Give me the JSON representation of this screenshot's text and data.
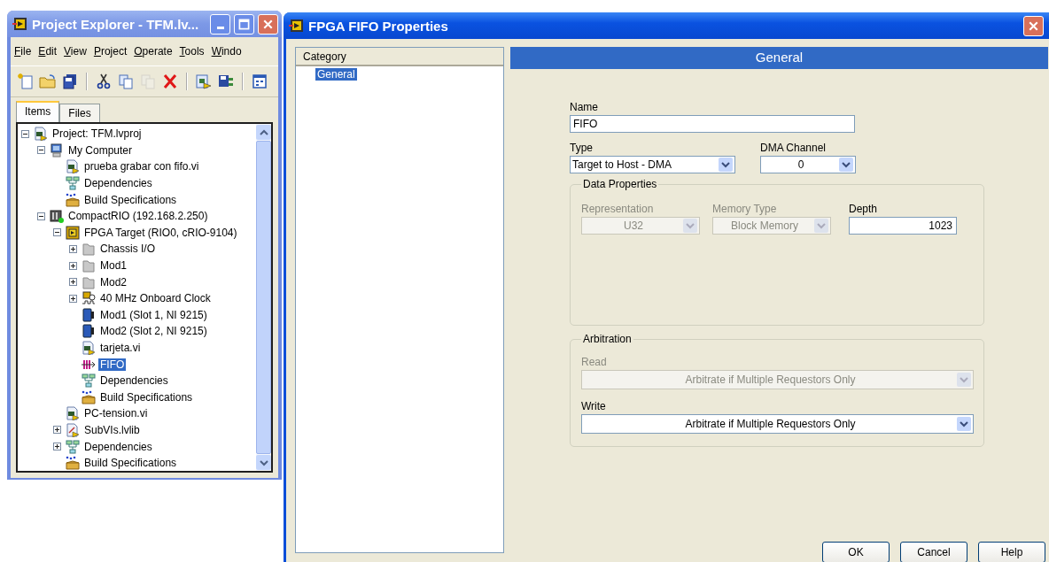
{
  "project_explorer": {
    "title": "Project Explorer - TFM.lv...",
    "menu": [
      "File",
      "Edit",
      "View",
      "Project",
      "Operate",
      "Tools",
      "Windo"
    ],
    "toolbar_groups": [
      {
        "tools": [
          {
            "kind": "new",
            "disabled": false
          },
          {
            "kind": "open",
            "disabled": false
          },
          {
            "kind": "save_all",
            "disabled": false
          }
        ]
      },
      {
        "tools": [
          {
            "kind": "cut",
            "disabled": false
          },
          {
            "kind": "copy",
            "disabled": false
          },
          {
            "kind": "paste",
            "disabled": true
          },
          {
            "kind": "delete",
            "disabled": false
          }
        ]
      },
      {
        "tools": [
          {
            "kind": "build",
            "disabled": false
          },
          {
            "kind": "save_build",
            "disabled": false
          }
        ]
      },
      {
        "tools": [
          {
            "kind": "window",
            "disabled": false
          }
        ]
      }
    ],
    "tabs": [
      {
        "label": "Items",
        "selected": true
      },
      {
        "label": "Files",
        "selected": false
      }
    ],
    "tree": [
      {
        "label": "Project: TFM.lvproj",
        "kind": "project",
        "expanded": true,
        "selected": false,
        "children": [
          {
            "label": "My Computer",
            "kind": "computer",
            "expanded": true,
            "selected": false,
            "children": [
              {
                "label": "prueba grabar con fifo.vi",
                "kind": "vi",
                "selected": false
              },
              {
                "label": "Dependencies",
                "kind": "dependencies",
                "selected": false
              },
              {
                "label": "Build Specifications",
                "kind": "build",
                "selected": false
              }
            ]
          },
          {
            "label": "CompactRIO (192.168.2.250)",
            "kind": "crio",
            "expanded": true,
            "selected": false,
            "children": [
              {
                "label": "FPGA Target (RIO0, cRIO-9104)",
                "kind": "fpga",
                "expanded": true,
                "selected": false,
                "children": [
                  {
                    "label": "Chassis I/O",
                    "kind": "folder",
                    "expanded": false,
                    "selected": false
                  },
                  {
                    "label": "Mod1",
                    "kind": "folder",
                    "expanded": false,
                    "selected": false
                  },
                  {
                    "label": "Mod2",
                    "kind": "folder",
                    "expanded": false,
                    "selected": false
                  },
                  {
                    "label": "40 MHz Onboard Clock",
                    "kind": "clock",
                    "expanded": false,
                    "selected": false
                  },
                  {
                    "label": "Mod1 (Slot 1, NI 9215)",
                    "kind": "module",
                    "selected": false
                  },
                  {
                    "label": "Mod2 (Slot 2, NI 9215)",
                    "kind": "module",
                    "selected": false
                  },
                  {
                    "label": "tarjeta.vi",
                    "kind": "vi",
                    "selected": false
                  },
                  {
                    "label": "FIFO",
                    "kind": "fifo",
                    "selected": true
                  },
                  {
                    "label": "Dependencies",
                    "kind": "dependencies",
                    "selected": false
                  },
                  {
                    "label": "Build Specifications",
                    "kind": "build",
                    "selected": false
                  }
                ]
              },
              {
                "label": "PC-tension.vi",
                "kind": "vi",
                "selected": false
              },
              {
                "label": "SubVIs.lvlib",
                "kind": "library",
                "expanded": false,
                "selected": false
              },
              {
                "label": "Dependencies",
                "kind": "dependencies",
                "expanded": false,
                "selected": false
              },
              {
                "label": "Build Specifications",
                "kind": "build",
                "selected": false
              }
            ]
          }
        ]
      }
    ]
  },
  "dialog": {
    "title": "FPGA FIFO Properties",
    "category_header": "Category",
    "categories": [
      {
        "label": "General",
        "selected": true
      }
    ],
    "section_title": "General",
    "name": {
      "label": "Name",
      "value": "FIFO"
    },
    "type": {
      "label": "Type",
      "value": "Target to Host - DMA"
    },
    "dma_channel": {
      "label": "DMA Channel",
      "value": "0"
    },
    "data_properties": {
      "title": "Data Properties",
      "fields": [
        {
          "label": "Representation",
          "value": "U32",
          "kind": "select",
          "disabled": true
        },
        {
          "label": "Memory Type",
          "value": "Block Memory",
          "kind": "select",
          "disabled": true
        },
        {
          "label": "Depth",
          "value": "1023",
          "kind": "number",
          "disabled": false
        }
      ]
    },
    "arbitration": {
      "title": "Arbitration",
      "fields": [
        {
          "label": "Read",
          "value": "Arbitrate if Multiple Requestors Only",
          "disabled": true
        },
        {
          "label": "Write",
          "value": "Arbitrate if Multiple Requestors Only",
          "disabled": false
        }
      ]
    },
    "buttons": [
      "OK",
      "Cancel",
      "Help"
    ]
  }
}
